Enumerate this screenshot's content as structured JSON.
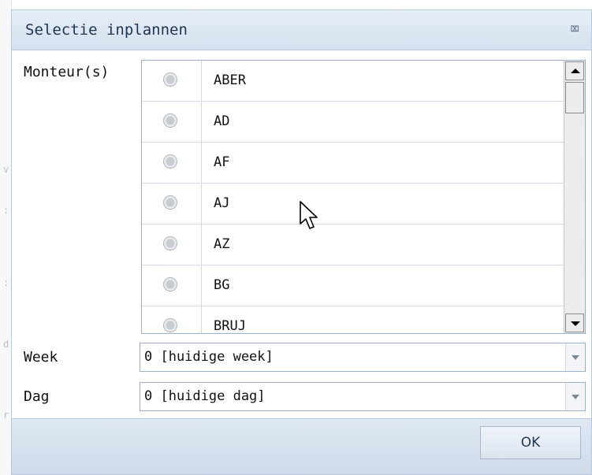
{
  "dialog": {
    "title": "Selectie inplannen",
    "close_icon": "close-x-icon"
  },
  "monteurs": {
    "label": "Monteur(s)",
    "items": [
      "ABER",
      "AD",
      "AF",
      "AJ",
      "AZ",
      "BG",
      "BRUJ"
    ]
  },
  "week": {
    "label": "Week",
    "value": "0 [huidige week]"
  },
  "dag": {
    "label": "Dag",
    "value": "0 [huidige dag]"
  },
  "footer": {
    "ok_label": "OK"
  },
  "colors": {
    "titlebar": "#dbe6f2",
    "border": "#9fb1c6",
    "title_text": "#1e3550"
  }
}
